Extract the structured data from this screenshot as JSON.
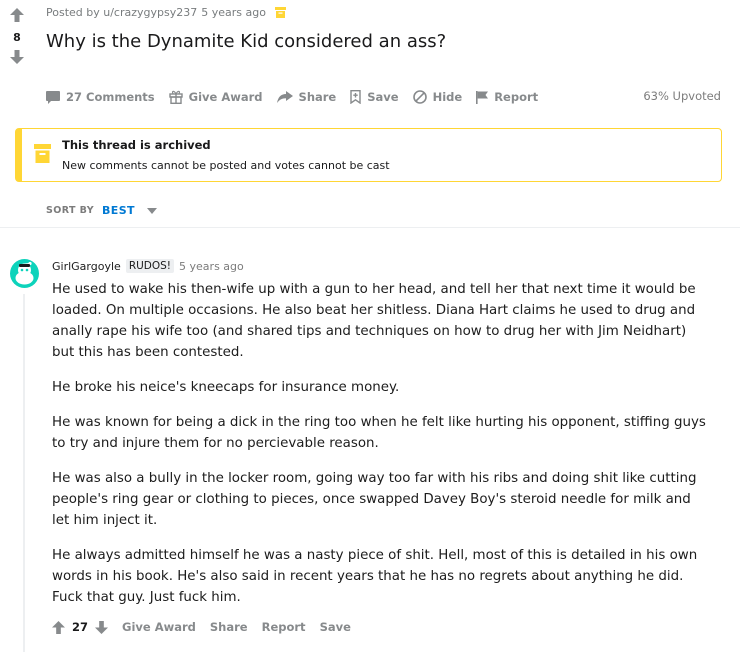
{
  "post": {
    "score": "8",
    "posted_by": "Posted by u/crazygypsy237",
    "time": "5 years ago",
    "title": "Why is the Dynamite Kid considered an ass?",
    "upvoted": "63% Upvoted",
    "actions": {
      "comments": "27 Comments",
      "give_award": "Give Award",
      "share": "Share",
      "save": "Save",
      "hide": "Hide",
      "report": "Report"
    }
  },
  "archived": {
    "title": "This thread is archived",
    "subtitle": "New comments cannot be posted and votes cannot be cast"
  },
  "sort": {
    "label": "SORT BY",
    "value": "BEST"
  },
  "comment": {
    "author": "GirlGargoyle",
    "flair": "RUDOS!",
    "time": "5 years ago",
    "paragraphs": [
      "He used to wake his then-wife up with a gun to her head, and tell her that next time it would be loaded. On multiple occasions. He also beat her shitless. Diana Hart claims he used to drug and anally rape his wife too (and shared tips and techniques on how to drug her with Jim Neidhart) but this has been contested.",
      "He broke his neice's kneecaps for insurance money.",
      "He was known for being a dick in the ring too when he felt like hurting his opponent, stiffing guys to try and injure them for no percievable reason.",
      "He was also a bully in the locker room, going way too far with his ribs and doing shit like cutting people's ring gear or clothing to pieces, once swapped Davey Boy's steroid needle for milk and let him inject it.",
      "He always admitted himself he was a nasty piece of shit. Hell, most of this is detailed in his own words in his book. He's also said in recent years that he has no regrets about anything he did. Fuck that guy. Just fuck him."
    ],
    "score": "27",
    "actions": {
      "give_award": "Give Award",
      "share": "Share",
      "report": "Report",
      "save": "Save"
    }
  },
  "colors": {
    "archive_yellow": "#ffd635",
    "sort_blue": "#0079d3",
    "action_gray": "#878a8c",
    "avatar_teal": "#0dd3bb"
  },
  "icons": {
    "upvote": "arrow-up-icon",
    "downvote": "arrow-down-icon",
    "comments": "comment-bubble-icon",
    "award": "gift-icon",
    "share": "share-arrow-icon",
    "save": "bookmark-icon",
    "hide": "hide-circle-icon",
    "report": "flag-icon",
    "archive": "archive-box-icon"
  }
}
